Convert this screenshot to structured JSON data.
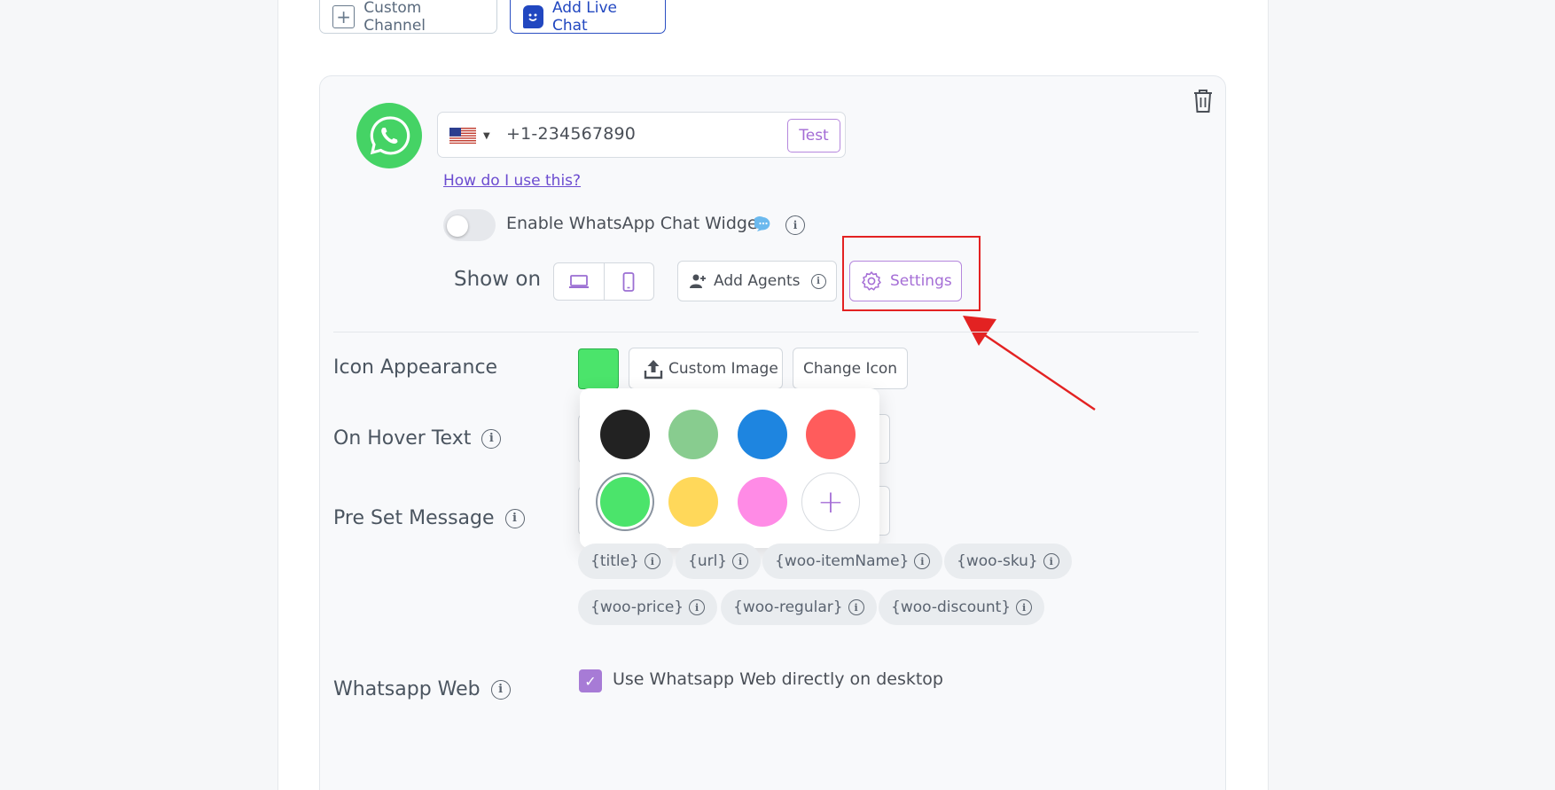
{
  "top_buttons": {
    "custom_channel": "Custom Channel",
    "add_live_chat": "Add Live Chat"
  },
  "channel": {
    "phone_value": "+1-234567890",
    "test_label": "Test",
    "how_link": "How do I use this?",
    "widget_label": "Enable WhatsApp Chat Widget",
    "widget_enabled": false,
    "show_on_label": "Show on",
    "add_agents_label": "Add Agents",
    "settings_label": "Settings"
  },
  "rows": {
    "icon_appearance": "Icon Appearance",
    "on_hover_text": "On Hover Text",
    "pre_set_message": "Pre Set Message",
    "whatsapp_web": "Whatsapp Web"
  },
  "appearance": {
    "selected_color": "#4be46b",
    "custom_image_label": "Custom Image",
    "change_icon_label": "Change Icon"
  },
  "color_options": [
    "#222222",
    "#88cc8f",
    "#1e85e0",
    "#ff5c5c",
    "#4be46b",
    "#ffd85a",
    "#ff8be6"
  ],
  "add_color_symbol": "+",
  "tags": {
    "title": "{title}",
    "url": "{url}",
    "woo_item_name": "{woo-itemName}",
    "woo_sku": "{woo-sku}",
    "woo_price": "{woo-price}",
    "woo_regular": "{woo-regular}",
    "woo_discount": "{woo-discount}"
  },
  "whatsapp_web": {
    "checked": true,
    "label": "Use Whatsapp Web directly on desktop"
  },
  "info_glyph": "i",
  "checkmark_glyph": "✓"
}
